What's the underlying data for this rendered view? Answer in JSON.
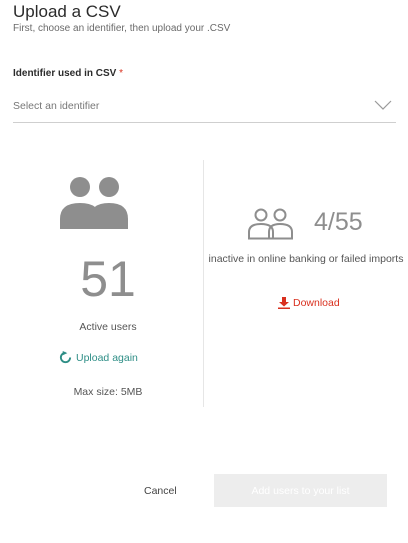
{
  "header": {
    "title": "Upload a CSV",
    "subtitle": "First, choose an identifier, then upload your .CSV"
  },
  "identifier": {
    "label": "Identifier used in CSV",
    "required_mark": "*",
    "placeholder": "Select an identifier"
  },
  "summary": {
    "active_count": "51",
    "active_label": "Active users",
    "upload_again_label": "Upload again",
    "max_size": "Max size: 5MB",
    "inactive_ratio": "4/55",
    "inactive_label": "inactive in online banking or failed imports",
    "download_label": "Download"
  },
  "footer": {
    "cancel_label": "Cancel",
    "add_label": "Add users to your list"
  },
  "colors": {
    "accent_teal": "#2e8e86",
    "accent_red": "#d9301f",
    "icon_gray": "#8e8e8e",
    "disabled_button": "#ededed"
  },
  "icons": {
    "users": "users-icon",
    "users_outline": "users-outline-icon",
    "refresh": "refresh-icon",
    "download": "download-icon",
    "chevron": "chevron-down-icon"
  }
}
